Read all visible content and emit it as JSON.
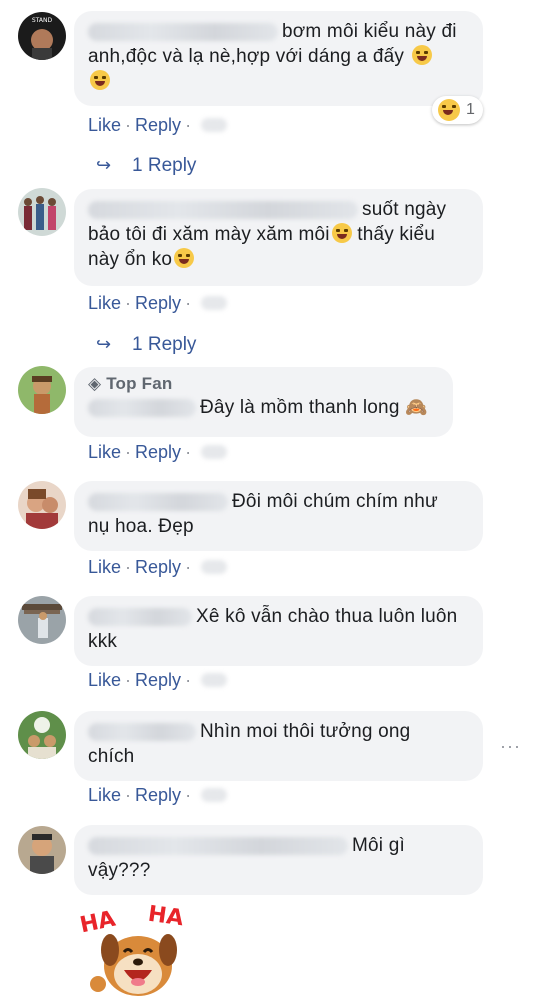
{
  "actions": {
    "like": "Like",
    "reply": "Reply",
    "separator": "·"
  },
  "comments": [
    {
      "text_line1": "bơm môi kiểu này đi",
      "text_line2": "anh,độc và lạ nè,hợp với dáng a đấy",
      "reaction_count": "1",
      "replies_label": "1 Reply"
    },
    {
      "text_line1": "suốt ngày",
      "text_line2": "bảo tôi đi xăm mày xăm môi",
      "text_line2b": "thấy kiểu",
      "text_line3": "này ổn ko",
      "replies_label": "1 Reply"
    },
    {
      "badge": "Top Fan",
      "text_line1": "Đây là mồm thanh long"
    },
    {
      "text_line1": "Đôi môi chúm chím như",
      "text_line2": "nụ hoa. Đẹp"
    },
    {
      "text_line1": "Xê kô vẫn chào thua luôn luôn",
      "text_line2": "kkk"
    },
    {
      "text_line1": "Nhìn moi thôi tưởng ong",
      "text_line2": "chích",
      "more_label": "···"
    },
    {
      "text_line1": "Môi gì",
      "text_line2": "vậy???"
    }
  ],
  "sticker": {
    "text_left": "HA",
    "text_right": "HA"
  },
  "colors": {
    "bubble": "#f2f3f5",
    "link": "#385898",
    "muted": "#606770"
  }
}
